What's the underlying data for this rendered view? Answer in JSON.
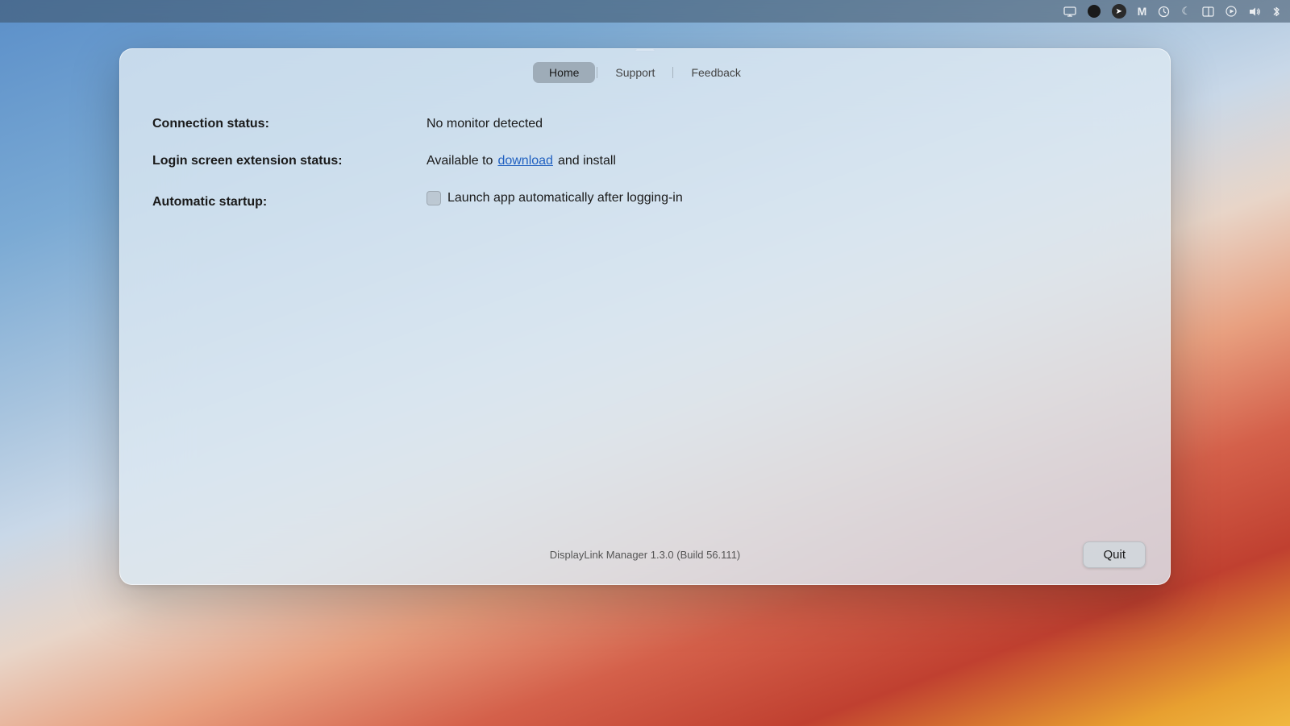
{
  "desktop": {
    "menubar": {
      "icons": [
        {
          "name": "monitor-icon",
          "symbol": "⬜"
        },
        {
          "name": "black-circle-icon",
          "symbol": "●"
        },
        {
          "name": "location-arrow-icon",
          "symbol": "➤"
        },
        {
          "name": "malwarebytes-icon",
          "symbol": "M"
        },
        {
          "name": "time-machine-icon",
          "symbol": "🕐"
        },
        {
          "name": "focus-moon-icon",
          "symbol": "☾"
        },
        {
          "name": "window-manager-icon",
          "symbol": "⧉"
        },
        {
          "name": "screen-recorder-icon",
          "symbol": "⏵"
        },
        {
          "name": "volume-icon",
          "symbol": "🔊"
        },
        {
          "name": "bluetooth-icon",
          "symbol": "⌘"
        }
      ]
    }
  },
  "popup": {
    "tabs": [
      {
        "id": "home",
        "label": "Home",
        "active": true
      },
      {
        "id": "support",
        "label": "Support",
        "active": false
      },
      {
        "id": "feedback",
        "label": "Feedback",
        "active": false
      }
    ],
    "content": {
      "rows": [
        {
          "label": "Connection status:",
          "value": "No monitor detected",
          "type": "text"
        },
        {
          "label": "Login screen extension status:",
          "value_prefix": "Available to ",
          "value_link": "download",
          "value_suffix": " and install",
          "type": "link"
        },
        {
          "label": "Automatic startup:",
          "value": "Launch app automatically after logging-in",
          "type": "checkbox",
          "checked": false
        }
      ]
    },
    "footer": {
      "version_text": "DisplayLink Manager 1.3.0 (Build 56.111)",
      "quit_button_label": "Quit"
    }
  }
}
